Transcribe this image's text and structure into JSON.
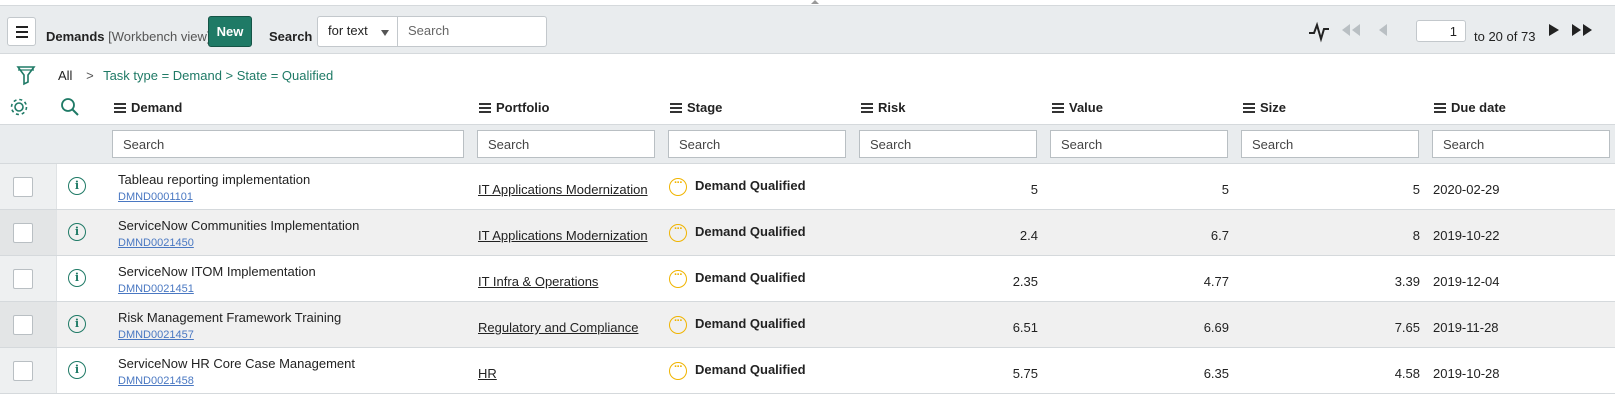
{
  "header": {
    "title": "Demands",
    "view": "[Workbench view]",
    "new_label": "New",
    "search_label": "Search",
    "search_field_option": "for text",
    "search_placeholder": "Search"
  },
  "pager": {
    "current_page": "1",
    "range_text": "to 20 of 73"
  },
  "breadcrumb": {
    "all": "All",
    "sep": ">",
    "conditions": "Task type = Demand > State = Qualified"
  },
  "columns": [
    {
      "label": "Demand",
      "search_placeholder": "Search"
    },
    {
      "label": "Portfolio",
      "search_placeholder": "Search"
    },
    {
      "label": "Stage",
      "search_placeholder": "Search"
    },
    {
      "label": "Risk",
      "search_placeholder": "Search"
    },
    {
      "label": "Value",
      "search_placeholder": "Search"
    },
    {
      "label": "Size",
      "search_placeholder": "Search"
    },
    {
      "label": "Due date",
      "search_placeholder": "Search"
    }
  ],
  "rows": [
    {
      "demand": "Tableau reporting implementation",
      "number": "DMND0001101",
      "portfolio": "IT Applications Modernization",
      "stage": "Demand Qualified",
      "risk": "5",
      "value": "5",
      "size": "5",
      "due": "2020-02-29"
    },
    {
      "demand": "ServiceNow Communities Implementation",
      "number": "DMND0021450",
      "portfolio": "IT Applications Modernization",
      "stage": "Demand Qualified",
      "risk": "2.4",
      "value": "6.7",
      "size": "8",
      "due": "2019-10-22"
    },
    {
      "demand": "ServiceNow ITOM Implementation",
      "number": "DMND0021451",
      "portfolio": "IT Infra & Operations",
      "stage": "Demand Qualified",
      "risk": "2.35",
      "value": "4.77",
      "size": "3.39",
      "due": "2019-12-04"
    },
    {
      "demand": "Risk Management Framework Training",
      "number": "DMND0021457",
      "portfolio": "Regulatory and Compliance",
      "stage": "Demand Qualified",
      "risk": "6.51",
      "value": "6.69",
      "size": "7.65",
      "due": "2019-11-28"
    },
    {
      "demand": "ServiceNow HR Core Case Management",
      "number": "DMND0021458",
      "portfolio": "HR",
      "stage": "Demand Qualified",
      "risk": "5.75",
      "value": "6.35",
      "size": "4.58",
      "due": "2019-10-28"
    }
  ],
  "colors": {
    "accent": "#1f7a66",
    "stage_icon": "#f0b400",
    "link": "#4a78c2"
  }
}
